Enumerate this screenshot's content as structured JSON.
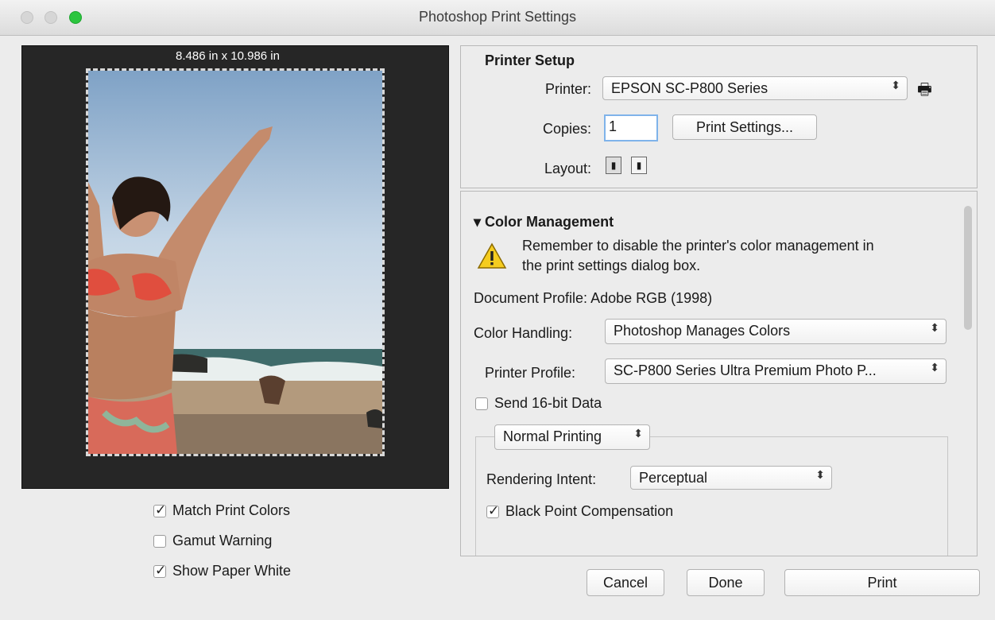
{
  "window": {
    "title": "Photoshop Print Settings"
  },
  "preview": {
    "dimensions": "8.486 in x 10.986 in",
    "options": [
      {
        "label": "Match Print Colors",
        "checked": true
      },
      {
        "label": "Gamut Warning",
        "checked": false
      },
      {
        "label": "Show Paper White",
        "checked": true
      }
    ]
  },
  "printer_setup": {
    "title": "Printer Setup",
    "printer_label": "Printer:",
    "printer_value": "EPSON SC-P800 Series",
    "copies_label": "Copies:",
    "copies_value": "1",
    "print_settings_button": "Print Settings...",
    "layout_label": "Layout:"
  },
  "color_management": {
    "title": "Color Management",
    "warning": "Remember to disable the printer's color management in the print settings dialog box.",
    "document_profile": "Document Profile: Adobe RGB (1998)",
    "color_handling_label": "Color Handling:",
    "color_handling_value": "Photoshop Manages Colors",
    "printer_profile_label": "Printer Profile:",
    "printer_profile_value": "SC-P800 Series Ultra Premium Photo P...",
    "send16_label": "Send 16-bit Data",
    "send16_checked": false,
    "printing_mode": "Normal Printing",
    "rendering_intent_label": "Rendering Intent:",
    "rendering_intent_value": "Perceptual",
    "bpc_label": "Black Point Compensation",
    "bpc_checked": true
  },
  "buttons": {
    "cancel": "Cancel",
    "done": "Done",
    "print": "Print"
  },
  "colors": {
    "accent": "#7fb3ea",
    "preview_bg": "#262626",
    "green_light": "#2bc53e"
  }
}
